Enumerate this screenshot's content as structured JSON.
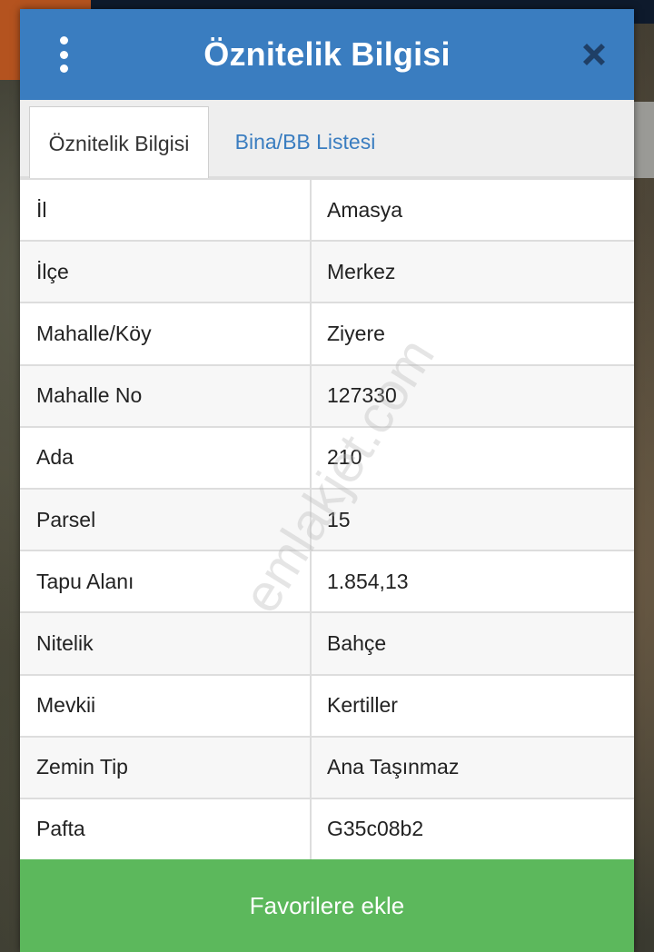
{
  "header": {
    "title": "Öznitelik Bilgisi"
  },
  "tabs": [
    {
      "label": "Öznitelik Bilgisi",
      "active": true
    },
    {
      "label": "Bina/BB Listesi",
      "active": false
    }
  ],
  "rows": [
    {
      "key": "İl",
      "value": "Amasya"
    },
    {
      "key": "İlçe",
      "value": "Merkez"
    },
    {
      "key": "Mahalle/Köy",
      "value": "Ziyere"
    },
    {
      "key": "Mahalle No",
      "value": "127330"
    },
    {
      "key": "Ada",
      "value": "210"
    },
    {
      "key": "Parsel",
      "value": "15"
    },
    {
      "key": "Tapu Alanı",
      "value": "1.854,13"
    },
    {
      "key": "Nitelik",
      "value": "Bahçe"
    },
    {
      "key": "Mevkii",
      "value": "Kertiller"
    },
    {
      "key": "Zemin Tip",
      "value": "Ana Taşınmaz"
    },
    {
      "key": "Pafta",
      "value": "G35c08b2"
    }
  ],
  "watermark": "emlakjet.com",
  "favorite_button": "Favorilere ekle",
  "icons": {
    "menu": "vertical-dots-icon",
    "close": "close-icon"
  },
  "colors": {
    "header": "#3a7dc0",
    "tab_link": "#3a7dc0",
    "favorite_button": "#5cb85c"
  }
}
